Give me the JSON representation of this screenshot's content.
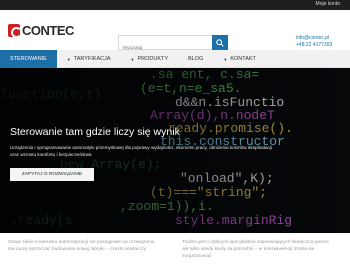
{
  "topbar": {
    "account": "Moje konto"
  },
  "brand": {
    "name": "CONTEC",
    "accent": "#cf1f25"
  },
  "search": {
    "placeholder": "Wyszukaj",
    "icon": "search-icon"
  },
  "contact": {
    "email": "info@contec.pl",
    "phone": "+48 22 4177393"
  },
  "nav": {
    "items": [
      {
        "label": "Sterowanie",
        "active": true,
        "dropdown": false
      },
      {
        "label": "Taryfikacja",
        "active": false,
        "dropdown": true
      },
      {
        "label": "Produkty",
        "active": false,
        "dropdown": true
      },
      {
        "label": "Blog",
        "active": false,
        "dropdown": false
      },
      {
        "label": "Kontakt",
        "active": false,
        "dropdown": true
      }
    ]
  },
  "hero": {
    "title": "Sterowanie tam gdzie liczy się wynik",
    "description": "Urządzenia i oprogramowanie automatyki przemysłowej dla poprawy wydajności, ekonomii pracy, obniżenia kosztów eksploatacji oraz wzrostu komfortu i bezpieczeństwa",
    "button": "Zapytaj o rozwiązanie"
  },
  "content": {
    "left": "Swoje siłów w kierunku automatyzacji nie poslugowie na rozwiązaniu ma muzę sprzeczać budowaniu nowej fabryki – często wystarczy",
    "right": "Trudno jest o dobrych specjalistów zapewniających skuteczna pomoc ale tylko wtedy kiedy są potrzebni – w konsekwencji trzeba sie zorganizować"
  },
  "colors": {
    "primary": "#1d6fa8",
    "dark": "#1f1f1f"
  }
}
